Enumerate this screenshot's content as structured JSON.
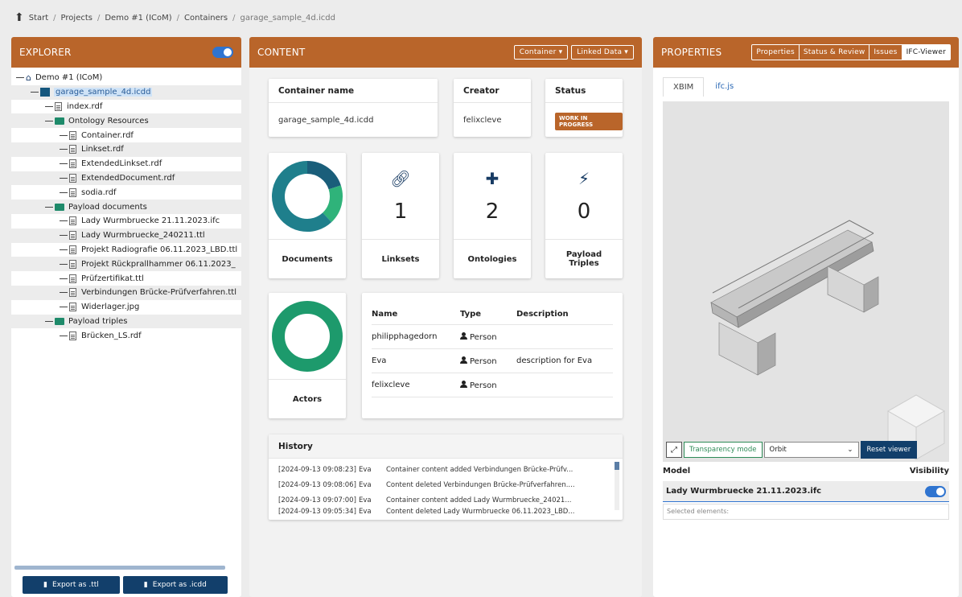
{
  "breadcrumb": {
    "items": [
      "Start",
      "Projects",
      "Demo #1 (ICoM)",
      "Containers"
    ],
    "current": "garage_sample_4d.icdd",
    "separator": "/"
  },
  "explorer": {
    "title": "EXPLORER",
    "tree": [
      {
        "label": "Demo #1 (ICoM)",
        "icon": "home-icon",
        "level": 0
      },
      {
        "label": "garage_sample_4d.icdd",
        "icon": "container-icon",
        "level": 1,
        "selected": true
      },
      {
        "label": "index.rdf",
        "icon": "file-icon",
        "level": 2
      },
      {
        "label": "Ontology Resources",
        "icon": "folder-icon",
        "level": 2
      },
      {
        "label": "Container.rdf",
        "icon": "file-icon",
        "level": 3
      },
      {
        "label": "Linkset.rdf",
        "icon": "file-icon",
        "level": 3
      },
      {
        "label": "ExtendedLinkset.rdf",
        "icon": "file-icon",
        "level": 3
      },
      {
        "label": "ExtendedDocument.rdf",
        "icon": "file-icon",
        "level": 3
      },
      {
        "label": "sodia.rdf",
        "icon": "file-icon",
        "level": 3
      },
      {
        "label": "Payload documents",
        "icon": "folder-icon",
        "level": 2
      },
      {
        "label": "Lady Wurmbruecke 21.11.2023.ifc",
        "icon": "file-icon",
        "level": 3
      },
      {
        "label": "Lady Wurmbruecke_240211.ttl",
        "icon": "file-icon",
        "level": 3
      },
      {
        "label": "Projekt Radiografie 06.11.2023_LBD.ttl",
        "icon": "file-icon",
        "level": 3
      },
      {
        "label": "Projekt Rückprallhammer 06.11.2023_",
        "icon": "file-icon",
        "level": 3
      },
      {
        "label": "Prüfzertifikat.ttl",
        "icon": "file-icon",
        "level": 3
      },
      {
        "label": "Verbindungen Brücke-Prüfverfahren.ttl",
        "icon": "file-icon",
        "level": 3
      },
      {
        "label": "Widerlager.jpg",
        "icon": "file-icon",
        "level": 3
      },
      {
        "label": "Payload triples",
        "icon": "folder-icon",
        "level": 2
      },
      {
        "label": "Brücken_LS.rdf",
        "icon": "file-icon",
        "level": 3
      }
    ],
    "export_ttl": "Export as .ttl",
    "export_icdd": "Export as .icdd",
    "toggle_on": true
  },
  "content": {
    "title": "CONTENT",
    "container_select": "Container ▾",
    "linked_data_select": "Linked Data ▾",
    "container_name_label": "Container name",
    "container_name": "garage_sample_4d.icdd",
    "creator_label": "Creator",
    "creator": "felixcleve",
    "status_label": "Status",
    "status": "WORK IN PROGRESS",
    "stats": {
      "documents_label": "Documents",
      "linksets_label": "Linksets",
      "linksets_count": "1",
      "ontologies_label": "Ontologies",
      "ontologies_count": "2",
      "payload_label": "Payload Triples",
      "payload_count": "0",
      "actors_label": "Actors"
    },
    "documents_donut": {
      "segments": [
        0.2,
        0.18,
        0.62
      ],
      "colors": [
        "#1a5e7a",
        "#2fb37a",
        "#1f7f8c"
      ]
    },
    "actors_donut": {
      "color": "#1d9a6c"
    },
    "actors": {
      "headers": [
        "Name",
        "Type",
        "Description"
      ],
      "rows": [
        {
          "name": "philipphagedorn",
          "type": "Person",
          "description": ""
        },
        {
          "name": "Eva",
          "type": "Person",
          "description": "description for Eva"
        },
        {
          "name": "felixcleve",
          "type": "Person",
          "description": ""
        }
      ]
    },
    "history": {
      "title": "History",
      "rows": [
        {
          "ts": "[2024-09-13 09:08:23]",
          "user": "Eva",
          "msg": "Container content added Verbindungen Brücke-Prüfv..."
        },
        {
          "ts": "[2024-09-13 09:08:06]",
          "user": "Eva",
          "msg": "Content deleted Verbindungen Brücke-Prüfverfahren...."
        },
        {
          "ts": "[2024-09-13 09:07:00]",
          "user": "Eva",
          "msg": "Container content added Lady Wurmbruecke_24021..."
        },
        {
          "ts": "[2024-09-13 09:05:34]",
          "user": "Eva",
          "msg": "Content deleted Lady Wurmbruecke 06.11.2023_LBD..."
        }
      ]
    }
  },
  "properties": {
    "title": "PROPERTIES",
    "tabs": [
      "Properties",
      "Status & Review",
      "Issues",
      "IFC-Viewer"
    ],
    "active_tab": "IFC-Viewer",
    "viewer_tabs": [
      "XBIM",
      "ifc.js"
    ],
    "transparency_label": "Transparency mode",
    "orbit_label": "Orbit",
    "reset_label": "Reset viewer",
    "model_label": "Model",
    "visibility_label": "Visibility",
    "model_name": "Lady Wurmbruecke 21.11.2023.ifc",
    "selected_elements": "Selected elements:"
  }
}
